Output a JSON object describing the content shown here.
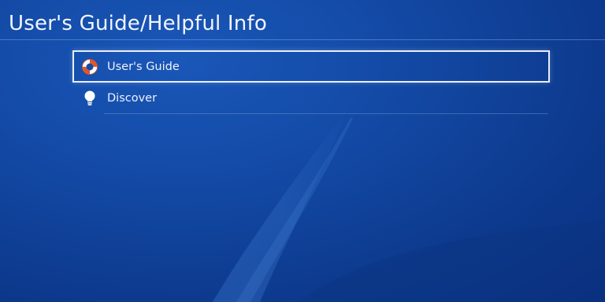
{
  "header": {
    "title": "User's Guide/Helpful Info"
  },
  "menu": {
    "items": [
      {
        "label": "User's Guide",
        "icon": "lifebuoy-icon",
        "selected": true
      },
      {
        "label": "Discover",
        "icon": "lightbulb-icon",
        "selected": false
      }
    ]
  },
  "colors": {
    "background": "#134aa6",
    "accent": "#e9eef8",
    "lifebuoy": "#e0562b"
  }
}
